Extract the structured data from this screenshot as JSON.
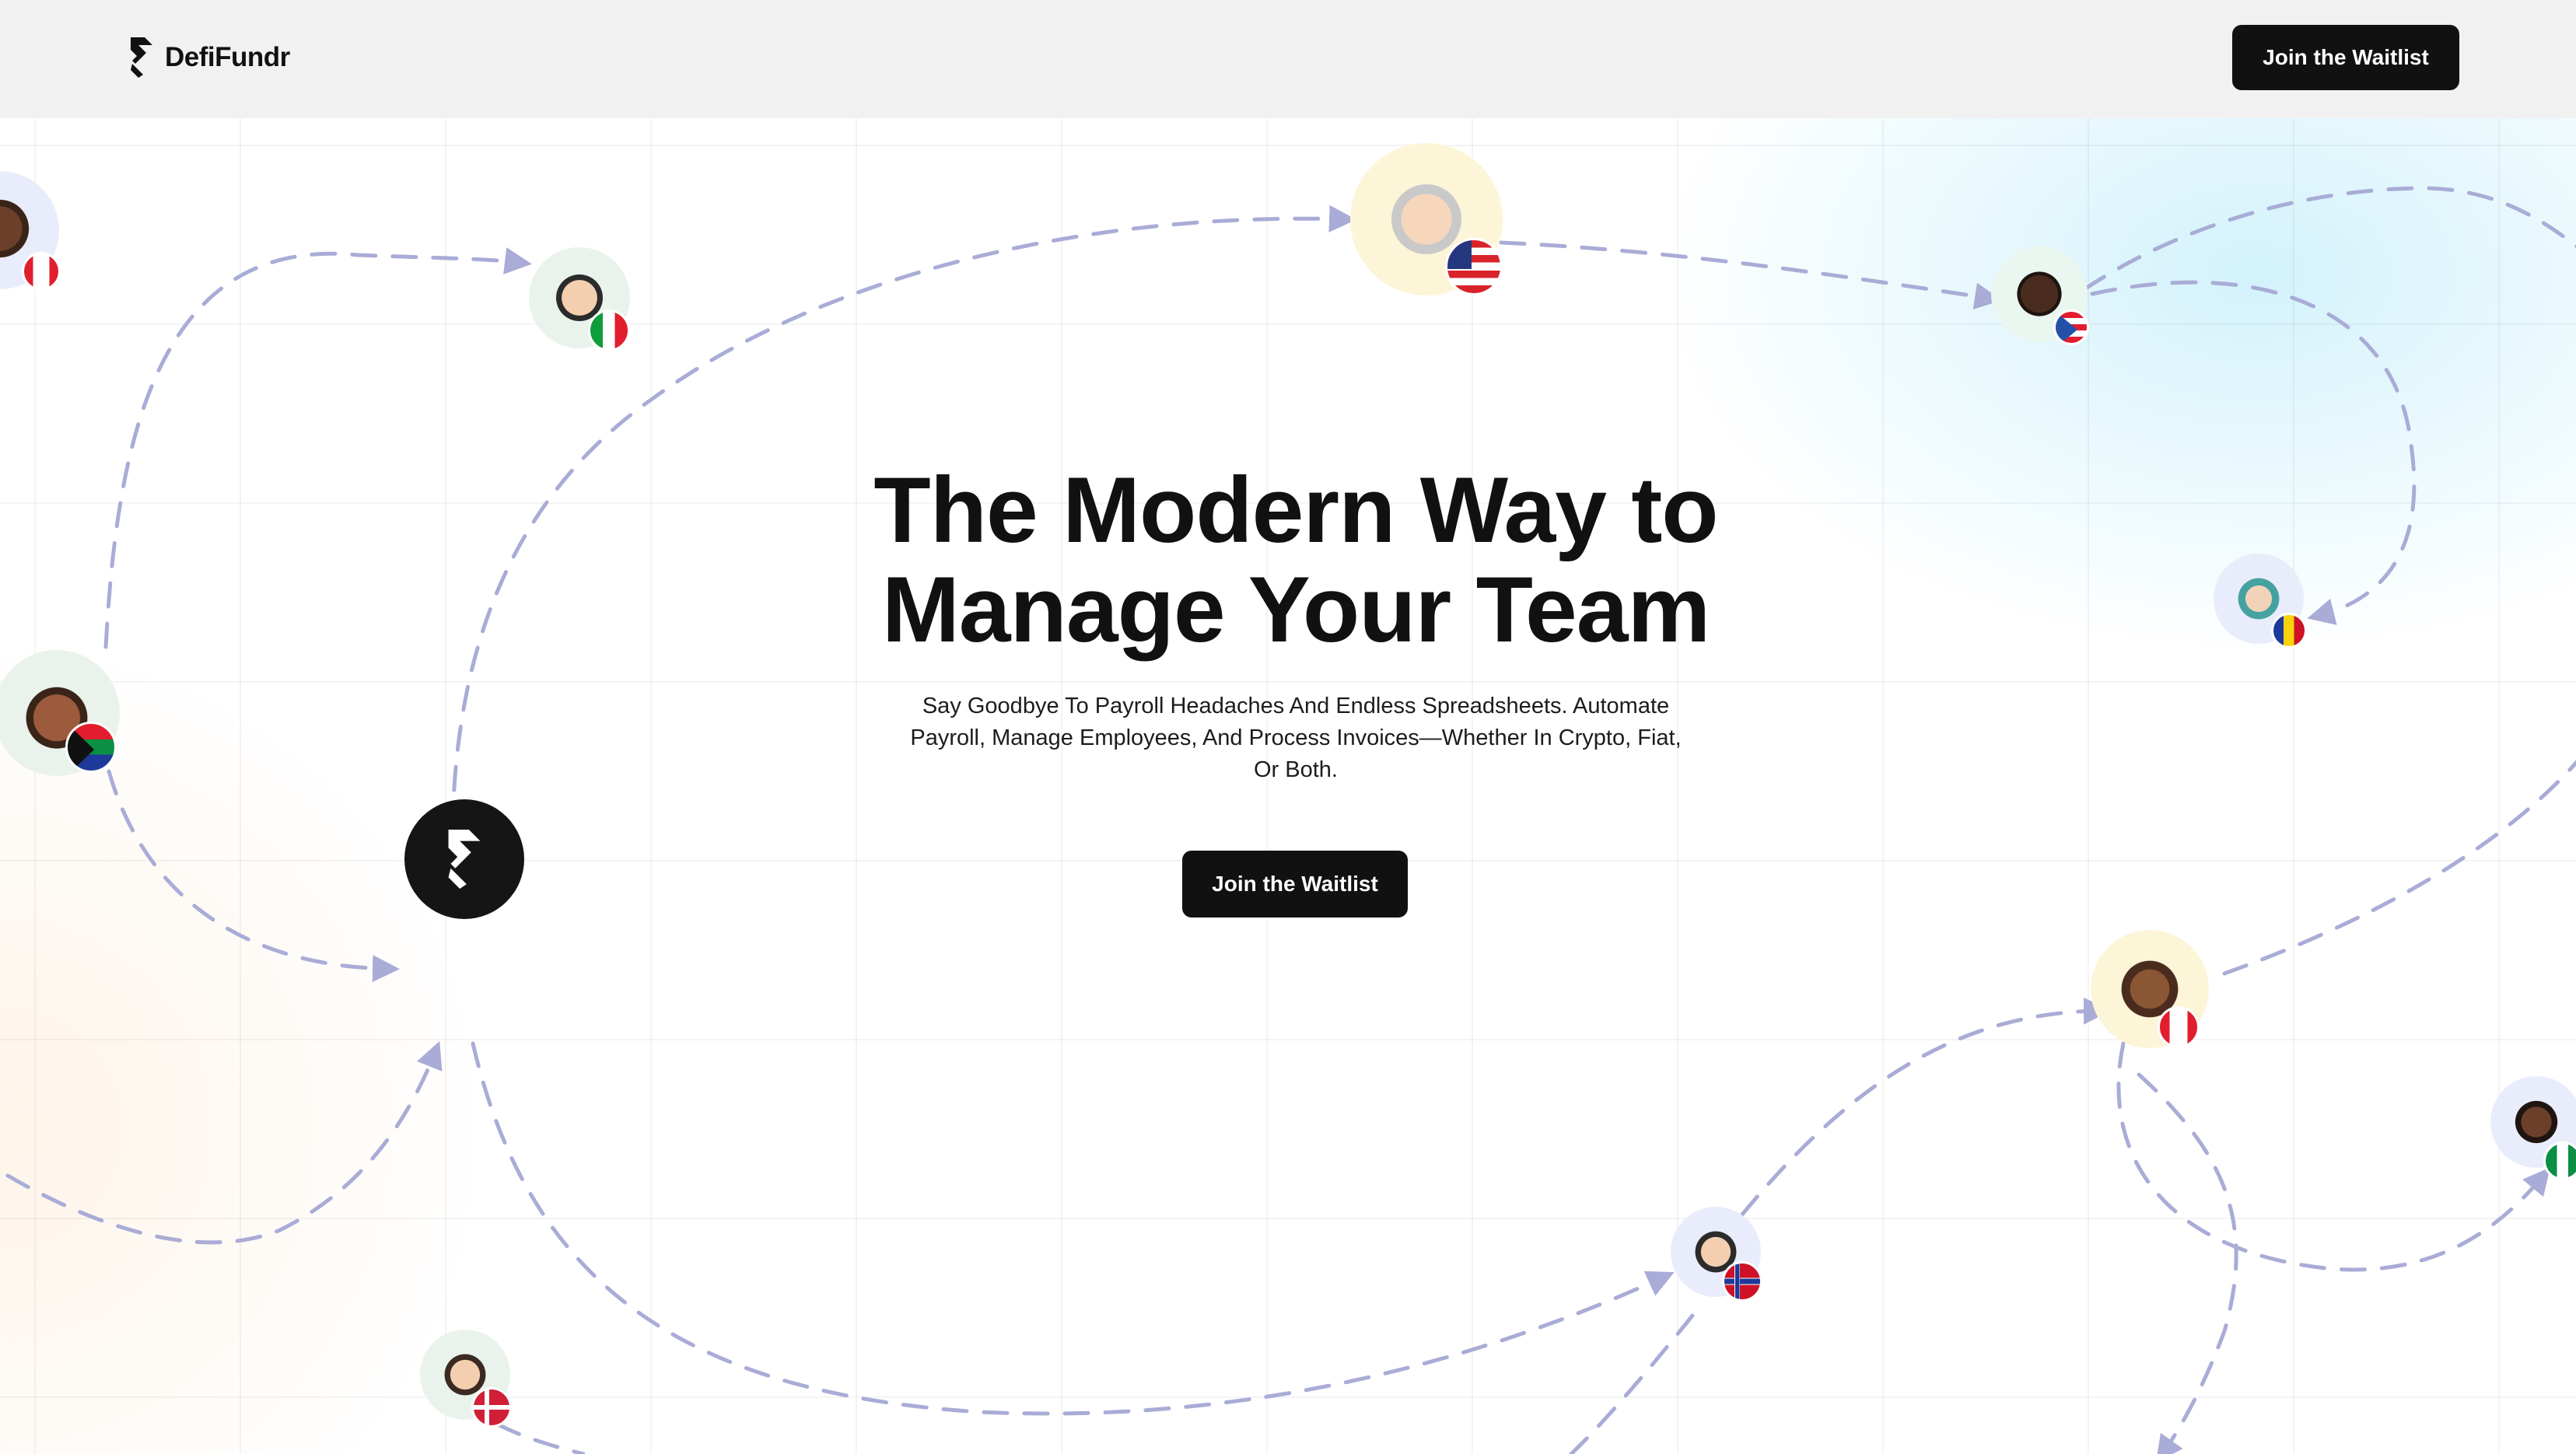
{
  "header": {
    "logo_text": "DefiFundr",
    "cta_label": "Join the Waitlist"
  },
  "hero": {
    "title_line1": "The Modern Way to",
    "title_line2": "Manage Your Team",
    "subtitle": "Say Goodbye To Payroll Headaches And Endless Spreadsheets. Automate Payroll, Manage Employees, And Process Invoices—Whether In Crypto, Fiat, Or Both.",
    "cta_label": "Join the Waitlist"
  },
  "colors": {
    "primary": "#111111",
    "path_dash": "#a9acd6",
    "header_bg": "#f1f1f1"
  },
  "avatars": [
    {
      "name": "avatar-canada-left",
      "flag": "canada"
    },
    {
      "name": "avatar-italy",
      "flag": "italy"
    },
    {
      "name": "avatar-usa",
      "flag": "usa"
    },
    {
      "name": "avatar-puerto-rico",
      "flag": "puerto-rico"
    },
    {
      "name": "avatar-romania",
      "flag": "romania"
    },
    {
      "name": "avatar-south-africa",
      "flag": "south-africa"
    },
    {
      "name": "avatar-canada-right",
      "flag": "canada"
    },
    {
      "name": "avatar-nigeria",
      "flag": "nigeria"
    },
    {
      "name": "avatar-norway",
      "flag": "norway"
    },
    {
      "name": "avatar-denmark",
      "flag": "denmark"
    }
  ]
}
